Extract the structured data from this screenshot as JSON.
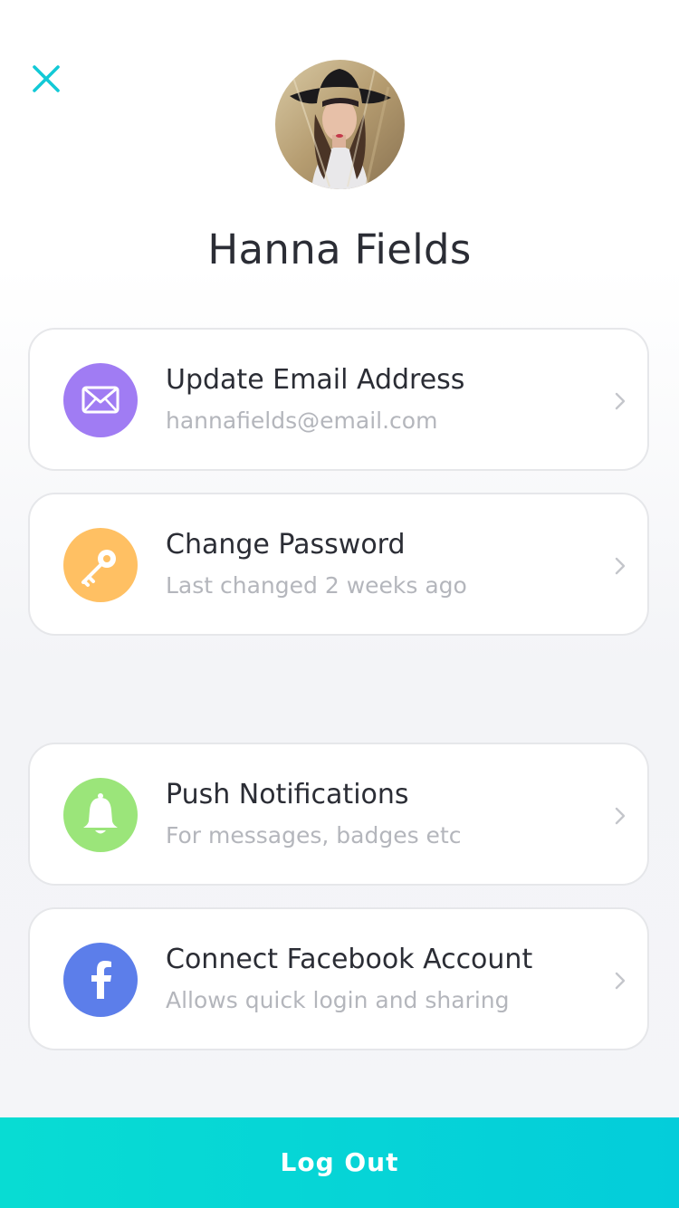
{
  "profile": {
    "name": "Hanna Fields"
  },
  "settings": [
    {
      "title": "Update Email Address",
      "subtitle": "hannafields@email.com",
      "icon": "envelope-icon",
      "color": "#a07cf3"
    },
    {
      "title": "Change Password",
      "subtitle": "Last changed 2 weeks ago",
      "icon": "key-icon",
      "color": "#ffc063"
    },
    {
      "title": "Push Notifications",
      "subtitle": "For messages, badges etc",
      "icon": "bell-icon",
      "color": "#9be57a"
    },
    {
      "title": "Connect Facebook Account",
      "subtitle": "Allows quick login and sharing",
      "icon": "facebook-icon",
      "color": "#5c7eea"
    }
  ],
  "footer": {
    "logout_label": "Log Out"
  },
  "colors": {
    "accent": "#00cbd8",
    "close_icon": "#12c9d6"
  }
}
